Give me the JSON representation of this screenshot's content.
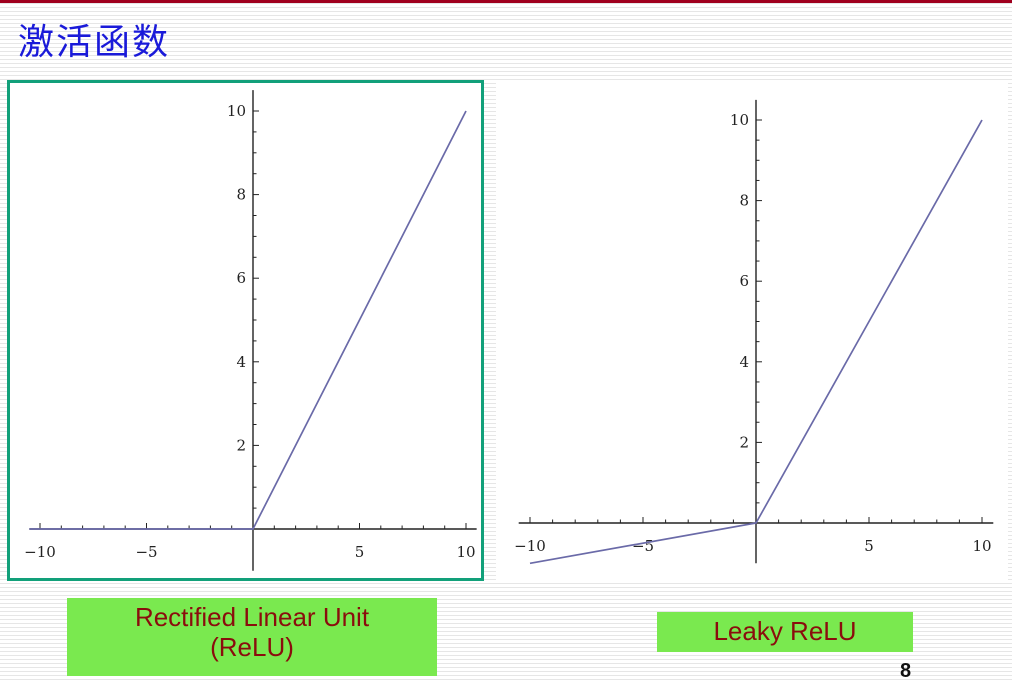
{
  "slide": {
    "title": "激活函数",
    "page_number": "8",
    "accent_color": "#a0001e",
    "title_color": "#1a1ad9"
  },
  "chart_data": [
    {
      "type": "line",
      "title": "",
      "xlabel": "",
      "ylabel": "",
      "xlim": [
        -10.5,
        10.5
      ],
      "ylim": [
        -1,
        10.5
      ],
      "x_ticks": [
        -10,
        -5,
        5,
        10
      ],
      "y_ticks": [
        2,
        4,
        6,
        8,
        10
      ],
      "grid": false,
      "series": [
        {
          "points": [
            [
              -10.5,
              0
            ],
            [
              0,
              0
            ],
            [
              10,
              10
            ]
          ],
          "color": "#6a6aa8"
        }
      ],
      "caption": [
        "Rectified Linear Unit",
        "(ReLU)"
      ]
    },
    {
      "type": "line",
      "title": "",
      "xlabel": "",
      "ylabel": "",
      "xlim": [
        -10.5,
        10.5
      ],
      "ylim": [
        -1,
        10.5
      ],
      "x_ticks": [
        -10,
        -5,
        5,
        10
      ],
      "y_ticks": [
        2,
        4,
        6,
        8,
        10
      ],
      "grid": false,
      "series": [
        {
          "points": [
            [
              -10,
              -1
            ],
            [
              0,
              0
            ],
            [
              10,
              10
            ]
          ],
          "color": "#6a6aa8"
        }
      ],
      "caption": [
        "Leaky ReLU"
      ]
    }
  ]
}
